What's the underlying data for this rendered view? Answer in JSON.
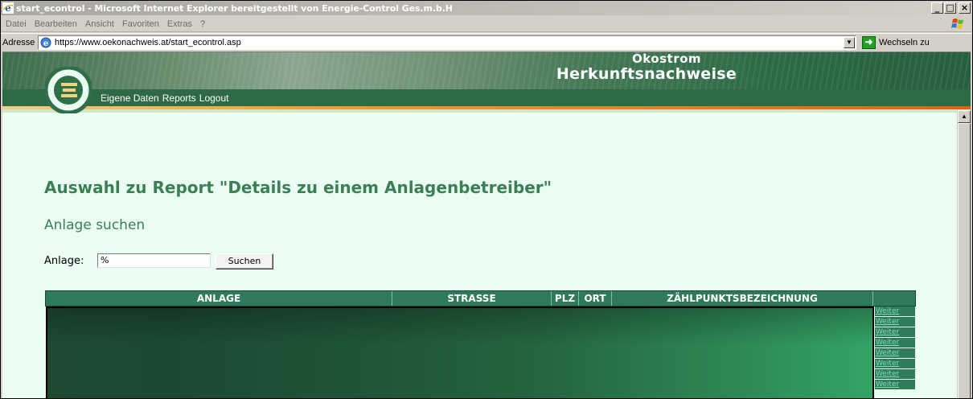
{
  "window": {
    "title": "start_econtrol - Microsoft Internet Explorer bereitgestellt von Energie-Control Ges.m.b.H",
    "controls": [
      "_",
      "□",
      "×"
    ]
  },
  "menubar": {
    "items": [
      "Datei",
      "Bearbeiten",
      "Ansicht",
      "Favoriten",
      "Extras",
      "?"
    ]
  },
  "addressbar": {
    "label": "Adresse",
    "url": "https://www.oekonachweis.at/start_econtrol.asp",
    "go_label": "Wechseln zu"
  },
  "site": {
    "brand_line1": "Ökostrom",
    "brand_line2": "Herkunftsnachweise",
    "nav": [
      "Eigene Daten",
      "Reports",
      "Logout"
    ]
  },
  "page": {
    "heading": "Auswahl zu Report \"Details zu einem Anlagenbetreiber\"",
    "subheading": "Anlage suchen",
    "search_label": "Anlage:",
    "search_value": "%",
    "search_button": "Suchen"
  },
  "table": {
    "columns": [
      "ANLAGE",
      "STRASSE",
      "PLZ",
      "ORT",
      "ZÄHLPUNKTSBEZEICHNUNG",
      ""
    ],
    "row_links": [
      "Weiter",
      "Weiter",
      "Weiter",
      "Weiter",
      "Weiter",
      "Weiter",
      "Weiter",
      "Weiter"
    ]
  },
  "colors": {
    "accent_green": "#3d7f55",
    "header_green": "#2f7a5b",
    "content_bg": "#e9fdf3"
  }
}
